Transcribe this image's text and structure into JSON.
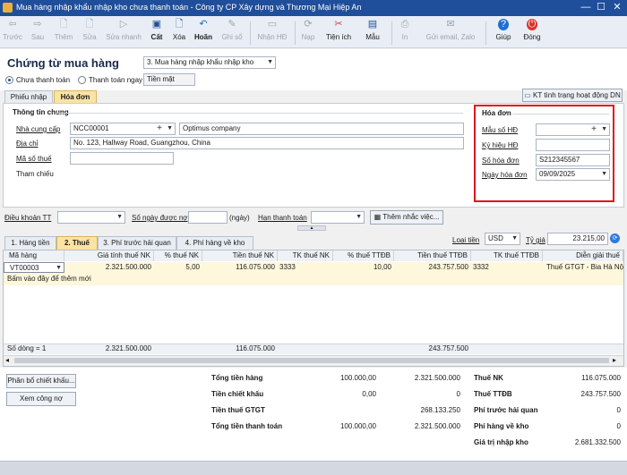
{
  "window": {
    "title": "Mua hàng nhập khẩu nhập kho chưa thanh toán - Công ty CP Xây dựng và Thương Mại Hiệp An",
    "minimize": "—",
    "maximize": "☐",
    "close": "✕"
  },
  "toolbar": {
    "items": [
      {
        "label": "Trước",
        "icon": "arrow-left-icon"
      },
      {
        "label": "Sau",
        "icon": "arrow-right-icon"
      },
      {
        "label": "Thêm",
        "icon": "add-doc-icon"
      },
      {
        "label": "Sửa",
        "icon": "edit-doc-icon"
      },
      {
        "label": "Sửa nhanh",
        "icon": "quick-edit-icon"
      },
      {
        "label": "Cất",
        "icon": "save-icon"
      },
      {
        "label": "Xóa",
        "icon": "delete-icon"
      },
      {
        "label": "Hoãn",
        "icon": "undo-icon"
      },
      {
        "label": "Ghi sổ",
        "icon": "post-icon"
      },
      {
        "label": "Nhận HĐ",
        "icon": "receive-invoice-icon"
      },
      {
        "label": "Nạp",
        "icon": "reload-icon"
      },
      {
        "label": "Tiện ích",
        "icon": "tools-icon"
      },
      {
        "label": "Mẫu",
        "icon": "template-icon"
      },
      {
        "label": "In",
        "icon": "print-icon"
      },
      {
        "label": "Gửi email, Zalo",
        "icon": "send-icon"
      },
      {
        "label": "Giúp",
        "icon": "help-icon"
      },
      {
        "label": "Đóng",
        "icon": "close-circle-icon"
      }
    ]
  },
  "header": {
    "title": "Chứng từ mua hàng",
    "voucher_type": "3. Mua hàng nhập khẩu nhập kho",
    "radio_unpaid": "Chưa thanh toán",
    "radio_paid": "Thanh toán ngay",
    "payment_method": "Tiền mặt"
  },
  "tabs": {
    "receipt": "Phiếu nhập",
    "invoice": "Hóa đơn",
    "check_status": "KT tình trạng hoạt động DN"
  },
  "general": {
    "section": "Thông tin chung",
    "supplier_label": "Nhà cung cấp",
    "supplier_code": "NCC00001",
    "supplier_name": "Optimus company",
    "address_label": "Địa chỉ",
    "address": "No. 123, Hallway Road, Guangzhou, China",
    "tax_label": "Mã số thuế",
    "tax_value": "",
    "ref_label": "Tham chiếu"
  },
  "invoice": {
    "section": "Hóa đơn",
    "form_label": "Mẫu số HĐ",
    "form_value": "",
    "symbol_label": "Ký hiệu HĐ",
    "symbol_value": "",
    "number_label": "Số hóa đơn",
    "number_value": "S212345567",
    "date_label": "Ngày hóa đơn",
    "date_value": "09/09/2025"
  },
  "terms": {
    "terms_label": "Điều khoản TT",
    "days_label": "Số ngày được nợ",
    "days_unit": "(ngày)",
    "due_label": "Hạn thanh toán",
    "reminder_button": "Thêm nhắc việc..."
  },
  "detail_tabs": [
    "1. Hàng tiền",
    "2. Thuế",
    "3. Phí trước hải quan",
    "4. Phí hàng về kho"
  ],
  "currency": {
    "label": "Loại tiền",
    "value": "USD",
    "rate_label": "Tỷ giá",
    "rate": "23.215,00"
  },
  "grid": {
    "headers": [
      "Mã hàng",
      "Giá tính thuế NK",
      "% thuế NK",
      "Tiền thuế NK",
      "TK thuế NK",
      "% thuế TTĐB",
      "Tiền thuế TTĐB",
      "TK thuế TTĐB",
      "Diễn giải thuế"
    ],
    "row": [
      "VT00003",
      "2.321.500.000",
      "5,00",
      "116.075.000",
      "3333",
      "10,00",
      "243.757.500",
      "3332",
      "Thuế GTGT - Bia Hà Nội"
    ],
    "add_hint": "Bấm vào đây để thêm mới",
    "footer_count": "Số dòng = 1",
    "footer_values": [
      "2.321.500.000",
      "116.075.000",
      "243.757.500"
    ]
  },
  "buttons": {
    "allocate": "Phân bổ chiết khấu...",
    "view_debt": "Xem công nợ"
  },
  "summary": {
    "left": [
      {
        "label": "Tổng tiền hàng",
        "v1": "100.000,00",
        "v2": "2.321.500.000"
      },
      {
        "label": "Tiền chiết khấu",
        "v1": "0,00",
        "v2": "0"
      },
      {
        "label": "Tiền thuế GTGT",
        "v1": "",
        "v2": "268.133.250"
      },
      {
        "label": "Tổng tiền thanh toán",
        "v1": "100.000,00",
        "v2": "2.321.500.000"
      }
    ],
    "right": [
      {
        "label": "Thuế NK",
        "value": "116.075.000"
      },
      {
        "label": "Thuế TTĐB",
        "value": "243.757.500"
      },
      {
        "label": "Phí trước hải quan",
        "value": "0"
      },
      {
        "label": "Phí hàng về kho",
        "value": "0"
      },
      {
        "label": "Giá trị nhập kho",
        "value": "2.681.332.500"
      }
    ]
  },
  "colors": {
    "title_bar": "#1f4e9a",
    "highlight_box": "#e0141c",
    "active_tab": "#fbe3a3"
  }
}
